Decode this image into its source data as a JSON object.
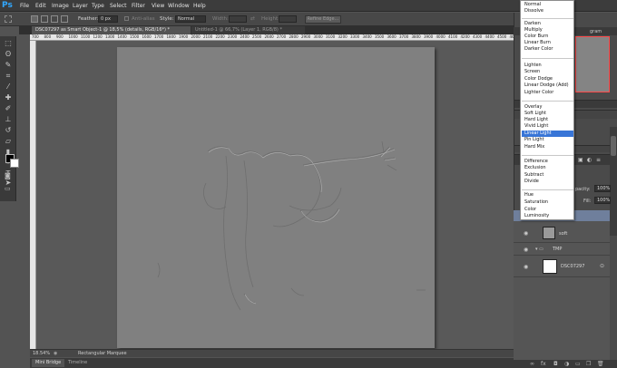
{
  "app": {
    "logo": "Ps"
  },
  "menu": [
    "File",
    "Edit",
    "Image",
    "Layer",
    "Type",
    "Select",
    "Filter",
    "View",
    "Window",
    "Help"
  ],
  "options": {
    "feather_label": "Feather:",
    "feather_value": "0 px",
    "antialias_label": "Anti-alias",
    "style_label": "Style:",
    "style_value": "Normal",
    "width_label": "Width:",
    "height_label": "Height:",
    "refine_label": "Refine Edge..."
  },
  "tabs": {
    "active": "DSC07297 as Smart Object-1 @ 18,5% (details, RGB/16*) *",
    "inactive": "Untitled-1 @ 66,7% (Layer 1, RGB/8) *"
  },
  "ruler_ticks": [
    "700",
    "800",
    "900",
    "1000",
    "1100",
    "1200",
    "1300",
    "1400",
    "1500",
    "1600",
    "1700",
    "1800",
    "1900",
    "2000",
    "2100",
    "2200",
    "2300",
    "2400",
    "2500",
    "2600",
    "2700",
    "2800",
    "2900",
    "3000",
    "3100",
    "3200",
    "3300",
    "3400",
    "3500",
    "3600",
    "3700",
    "3800",
    "3900",
    "4000",
    "4100",
    "4200",
    "4300",
    "4400",
    "4500",
    "4600"
  ],
  "status": {
    "zoom": "18.54%",
    "tool": "Rectangular Marquee"
  },
  "bottom_tabs": {
    "mini_bridge": "Mini Bridge",
    "timeline": "Timeline"
  },
  "panel": {
    "navigator_label": "gram",
    "opacity_label": "pacity:",
    "opacity_value": "100%",
    "fill_label": "Fill:",
    "fill_value": "100%"
  },
  "layers": [
    {
      "name": "soft"
    },
    {
      "name": "TMP"
    },
    {
      "name": "DSC07297"
    }
  ],
  "blend_modes": {
    "group1": [
      "Normal",
      "Dissolve"
    ],
    "group2": [
      "Darken",
      "Multiply",
      "Color Burn",
      "Linear Burn",
      "Darker Color"
    ],
    "group3": [
      "Lighten",
      "Screen",
      "Color Dodge",
      "Linear Dodge (Add)",
      "Lighter Color"
    ],
    "group4": [
      "Overlay",
      "Soft Light",
      "Hard Light",
      "Vivid Light",
      "Linear Light",
      "Pin Light",
      "Hard Mix"
    ],
    "group5": [
      "Difference",
      "Exclusion",
      "Subtract",
      "Divide"
    ],
    "group6": [
      "Hue",
      "Saturation",
      "Color",
      "Luminosity"
    ],
    "selected": "Linear Light"
  },
  "colors": {
    "accent": "#3875d7",
    "highlight": "#ff4a4a",
    "logo": "#31a8ff"
  }
}
